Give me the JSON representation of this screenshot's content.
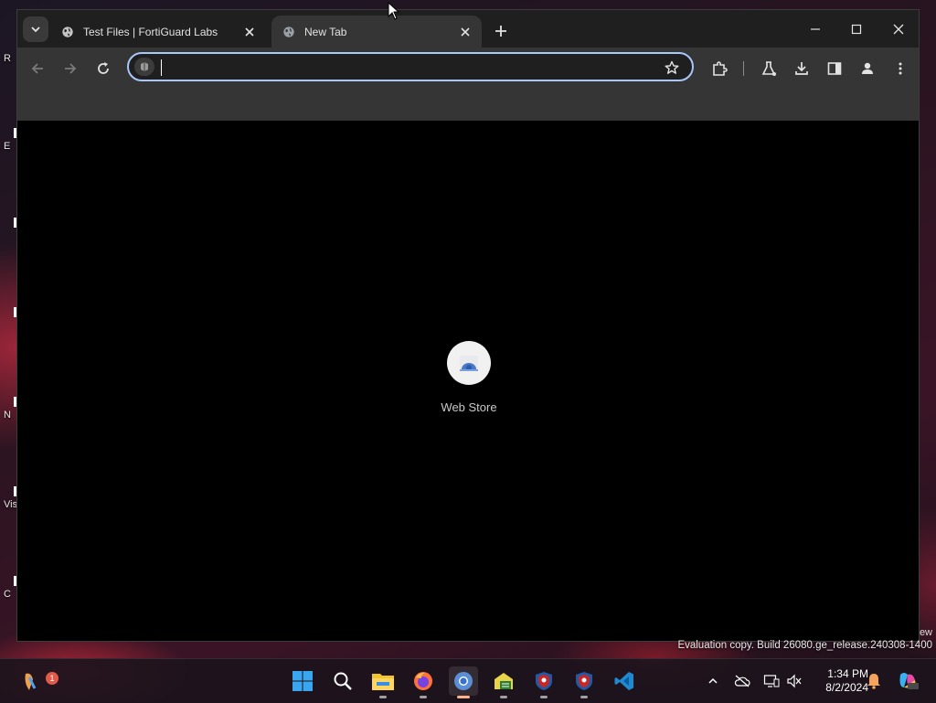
{
  "tabs": [
    {
      "title": "Test Files | FortiGuard Labs",
      "active": false
    },
    {
      "title": "New Tab",
      "active": true
    }
  ],
  "address_bar": {
    "value": "",
    "placeholder": ""
  },
  "new_tab_page": {
    "shortcuts": [
      {
        "label": "Web Store",
        "icon": "web-store-icon"
      }
    ]
  },
  "desktop": {
    "icon_label_fragments": [
      "R",
      "E",
      "N",
      "Vis",
      "C"
    ],
    "watermark": "Evaluation copy. Build 26080.ge_release.240308-1400",
    "watermark_fragment": "ew"
  },
  "taskbar": {
    "apps": [
      "start-icon",
      "search-icon",
      "file-explorer-icon",
      "firefox-icon",
      "chrome-icon",
      "file-manager-icon",
      "shield-app-icon",
      "shield-app-2-icon",
      "vscode-icon"
    ],
    "active_app": "chrome-icon",
    "notification_badge": "1",
    "clock": {
      "time": "1:34 PM",
      "date": "8/2/2024"
    }
  },
  "colors": {
    "omnibox_focus": "#a8c7fa",
    "toolbar_bg": "#353535",
    "tabstrip_bg": "#1f1f1f",
    "page_bg": "#000000"
  }
}
